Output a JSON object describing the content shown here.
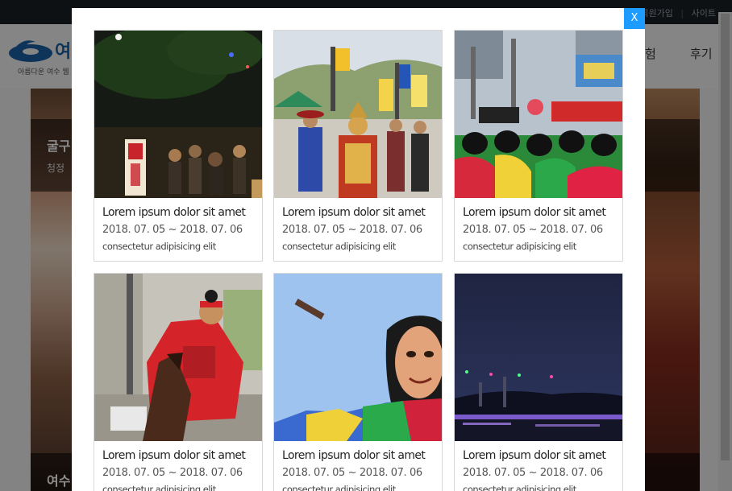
{
  "background_page": {
    "topbar_links": [
      "회원가입",
      "사이트"
    ],
    "logo": {
      "brand": "여",
      "tagline": "아름다운 여수 웹"
    },
    "nav": [
      "험",
      "후기"
    ],
    "band1": {
      "title": "굴구",
      "subtitle": "청정"
    },
    "band2": {
      "title": "여수"
    }
  },
  "modal": {
    "close_label": "X",
    "accent_color": "#1e9bff",
    "cards": [
      {
        "title": "Lorem ipsum dolor sit amet",
        "date": "2018. 07. 05 ~ 2018. 07. 06",
        "desc": "consectetur adipisicing elit",
        "image": "night-parade-photo"
      },
      {
        "title": "Lorem ipsum dolor sit amet",
        "date": "2018. 07. 05 ~ 2018. 07. 06",
        "desc": "consectetur adipisicing elit",
        "image": "armored-general-procession-photo"
      },
      {
        "title": "Lorem ipsum dolor sit amet",
        "date": "2018. 07. 05 ~ 2018. 07. 06",
        "desc": "consectetur adipisicing elit",
        "image": "traditional-dancers-stage-photo"
      },
      {
        "title": "Lorem ipsum dolor sit amet",
        "date": "2018. 07. 05 ~ 2018. 07. 06",
        "desc": "consectetur adipisicing elit",
        "image": "horse-rider-red-robe-photo"
      },
      {
        "title": "Lorem ipsum dolor sit amet",
        "date": "2018. 07. 05 ~ 2018. 07. 06",
        "desc": "consectetur adipisicing elit",
        "image": "mask-dancer-sky-photo"
      },
      {
        "title": "Lorem ipsum dolor sit amet",
        "date": "2018. 07. 05 ~ 2018. 07. 06",
        "desc": "consectetur adipisicing elit",
        "image": "night-bridge-lights-photo"
      }
    ]
  }
}
